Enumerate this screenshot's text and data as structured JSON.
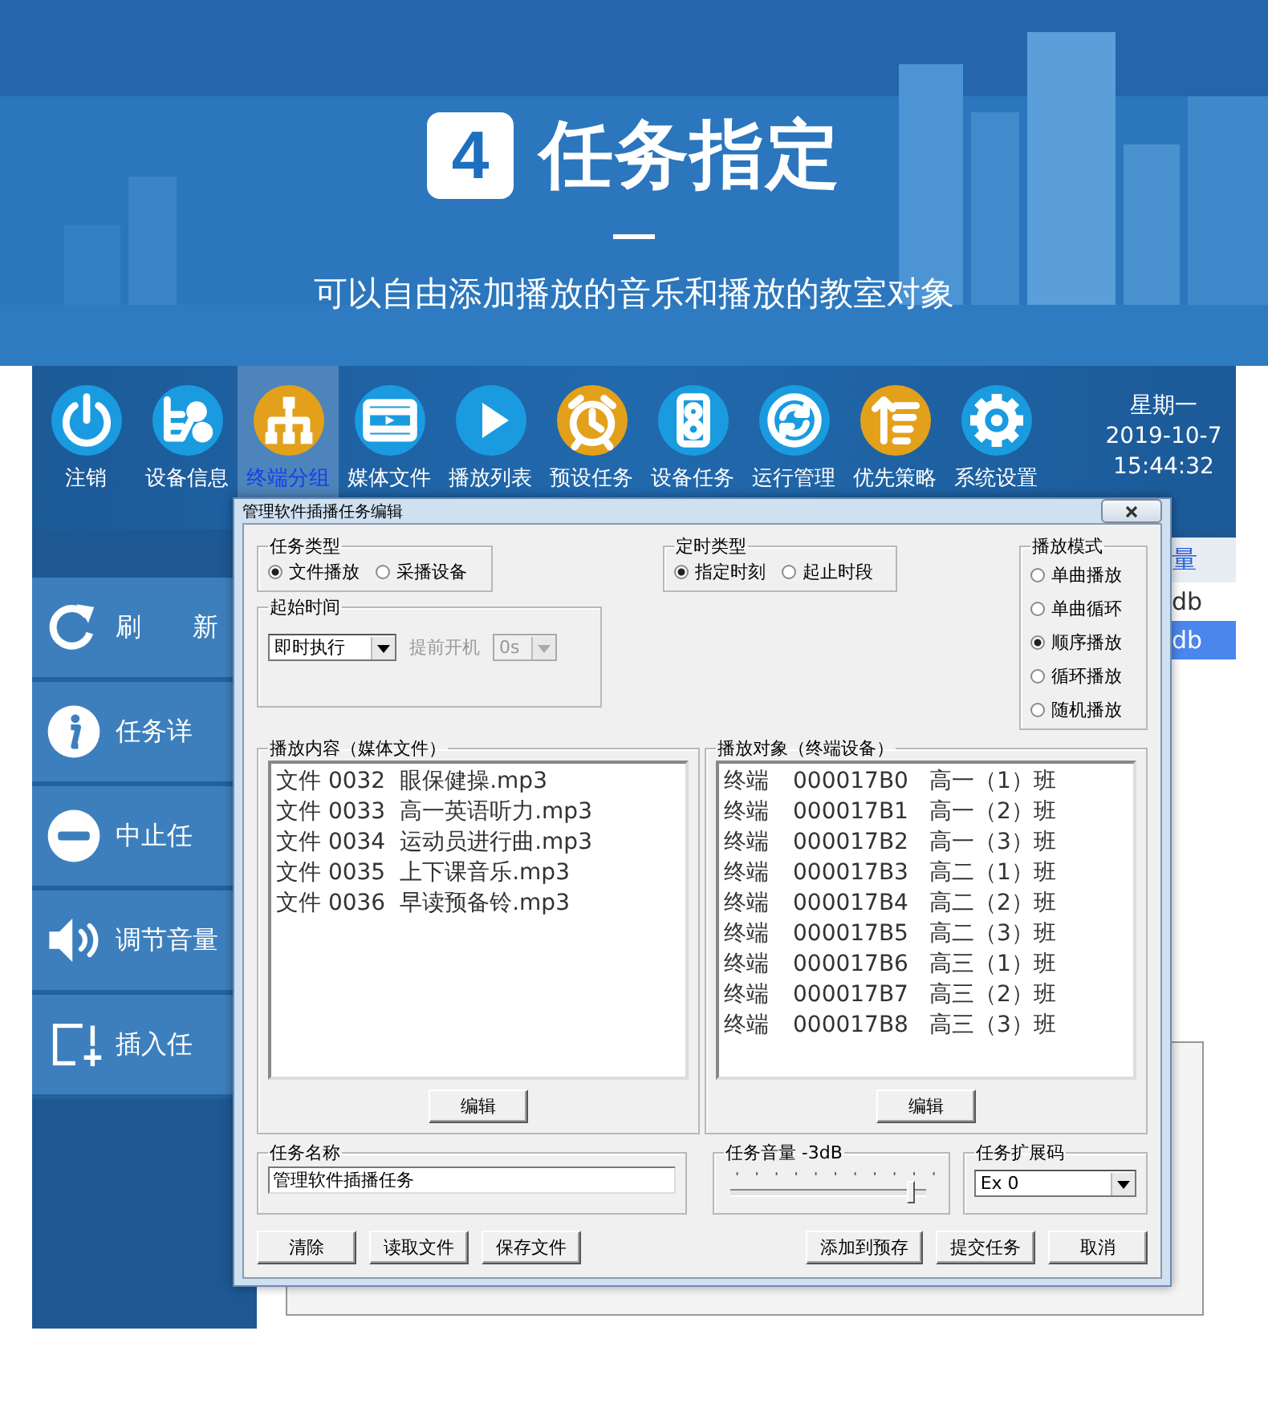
{
  "hero": {
    "step": "4",
    "title": "任务指定",
    "subtitle": "可以自由添加播放的音乐和播放的教室对象"
  },
  "toolbar": {
    "items": [
      {
        "label": "注销",
        "kind": "power",
        "color": "#1a9be0",
        "selected": false
      },
      {
        "label": "设备信息",
        "kind": "device",
        "color": "#1a9be0",
        "selected": false
      },
      {
        "label": "终端分组",
        "kind": "tree",
        "color": "#e3a01b",
        "selected": true
      },
      {
        "label": "媒体文件",
        "kind": "film",
        "color": "#1a9be0",
        "selected": false
      },
      {
        "label": "播放列表",
        "kind": "play",
        "color": "#1a9be0",
        "selected": false
      },
      {
        "label": "预设任务",
        "kind": "clock",
        "color": "#e3a01b",
        "selected": false
      },
      {
        "label": "设备任务",
        "kind": "speaker",
        "color": "#1a9be0",
        "selected": false
      },
      {
        "label": "运行管理",
        "kind": "cycle",
        "color": "#1a9be0",
        "selected": false
      },
      {
        "label": "优先策略",
        "kind": "sort",
        "color": "#e3a01b",
        "selected": false
      },
      {
        "label": "系统设置",
        "kind": "gear",
        "color": "#1a9be0",
        "selected": false
      }
    ],
    "clock": {
      "weekday": "星期一",
      "date": "2019-10-7",
      "time": "15:44:32"
    }
  },
  "sidebar": {
    "items": [
      {
        "label": "刷　　新",
        "kind": "refresh"
      },
      {
        "label": "任务详",
        "kind": "info"
      },
      {
        "label": "中止任",
        "kind": "minus"
      },
      {
        "label": "调节音量",
        "kind": "volume"
      },
      {
        "label": "插入任",
        "kind": "add"
      }
    ]
  },
  "table": {
    "column_header": "量",
    "rows": [
      {
        "cell": "db",
        "selected": false
      },
      {
        "cell": "db",
        "selected": true
      }
    ]
  },
  "dialog": {
    "title": "管理软件插播任务编辑",
    "task_type": {
      "label": "任务类型",
      "options": [
        {
          "label": "文件播放",
          "selected": true
        },
        {
          "label": "采播设备",
          "selected": false
        }
      ]
    },
    "timing_type": {
      "label": "定时类型",
      "options": [
        {
          "label": "指定时刻",
          "selected": true
        },
        {
          "label": "起止时段",
          "selected": false
        }
      ]
    },
    "play_mode": {
      "label": "播放模式",
      "options": [
        {
          "label": "单曲播放",
          "selected": false
        },
        {
          "label": "单曲循环",
          "selected": false
        },
        {
          "label": "顺序播放",
          "selected": true
        },
        {
          "label": "循环播放",
          "selected": false
        },
        {
          "label": "随机播放",
          "selected": false
        }
      ]
    },
    "start_time": {
      "label": "起始时间",
      "value": "即时执行",
      "advance_label": "提前开机",
      "advance_value": "0s",
      "advance_disabled": true
    },
    "media": {
      "label": "播放内容（媒体文件）",
      "button": "编辑",
      "items": [
        {
          "id": "文件 0032",
          "name": "眼保健操.mp3"
        },
        {
          "id": "文件 0033",
          "name": "高一英语听力.mp3"
        },
        {
          "id": "文件 0034",
          "name": "运动员进行曲.mp3"
        },
        {
          "id": "文件 0035",
          "name": "上下课音乐.mp3"
        },
        {
          "id": "文件 0036",
          "name": "早读预备铃.mp3"
        }
      ]
    },
    "targets": {
      "label": "播放对象（终端设备）",
      "button": "编辑",
      "items": [
        {
          "type": "终端",
          "code": "000017B0",
          "name": "高一（1）班"
        },
        {
          "type": "终端",
          "code": "000017B1",
          "name": "高一（2）班"
        },
        {
          "type": "终端",
          "code": "000017B2",
          "name": "高一（3）班"
        },
        {
          "type": "终端",
          "code": "000017B3",
          "name": "高二（1）班"
        },
        {
          "type": "终端",
          "code": "000017B4",
          "name": "高二（2）班"
        },
        {
          "type": "终端",
          "code": "000017B5",
          "name": "高二（3）班"
        },
        {
          "type": "终端",
          "code": "000017B6",
          "name": "高三（1）班"
        },
        {
          "type": "终端",
          "code": "000017B7",
          "name": "高三（2）班"
        },
        {
          "type": "终端",
          "code": "000017B8",
          "name": "高三（3）班"
        }
      ]
    },
    "task_name": {
      "label": "任务名称",
      "value": "管理软件插播任务"
    },
    "volume": {
      "label": "任务音量 -3dB",
      "level": 0.93
    },
    "ext_code": {
      "label": "任务扩展码",
      "value": "Ex 0"
    },
    "buttons_left": [
      "清除",
      "读取文件",
      "保存文件"
    ],
    "buttons_right": [
      "添加到预存",
      "提交任务",
      "取消"
    ]
  }
}
